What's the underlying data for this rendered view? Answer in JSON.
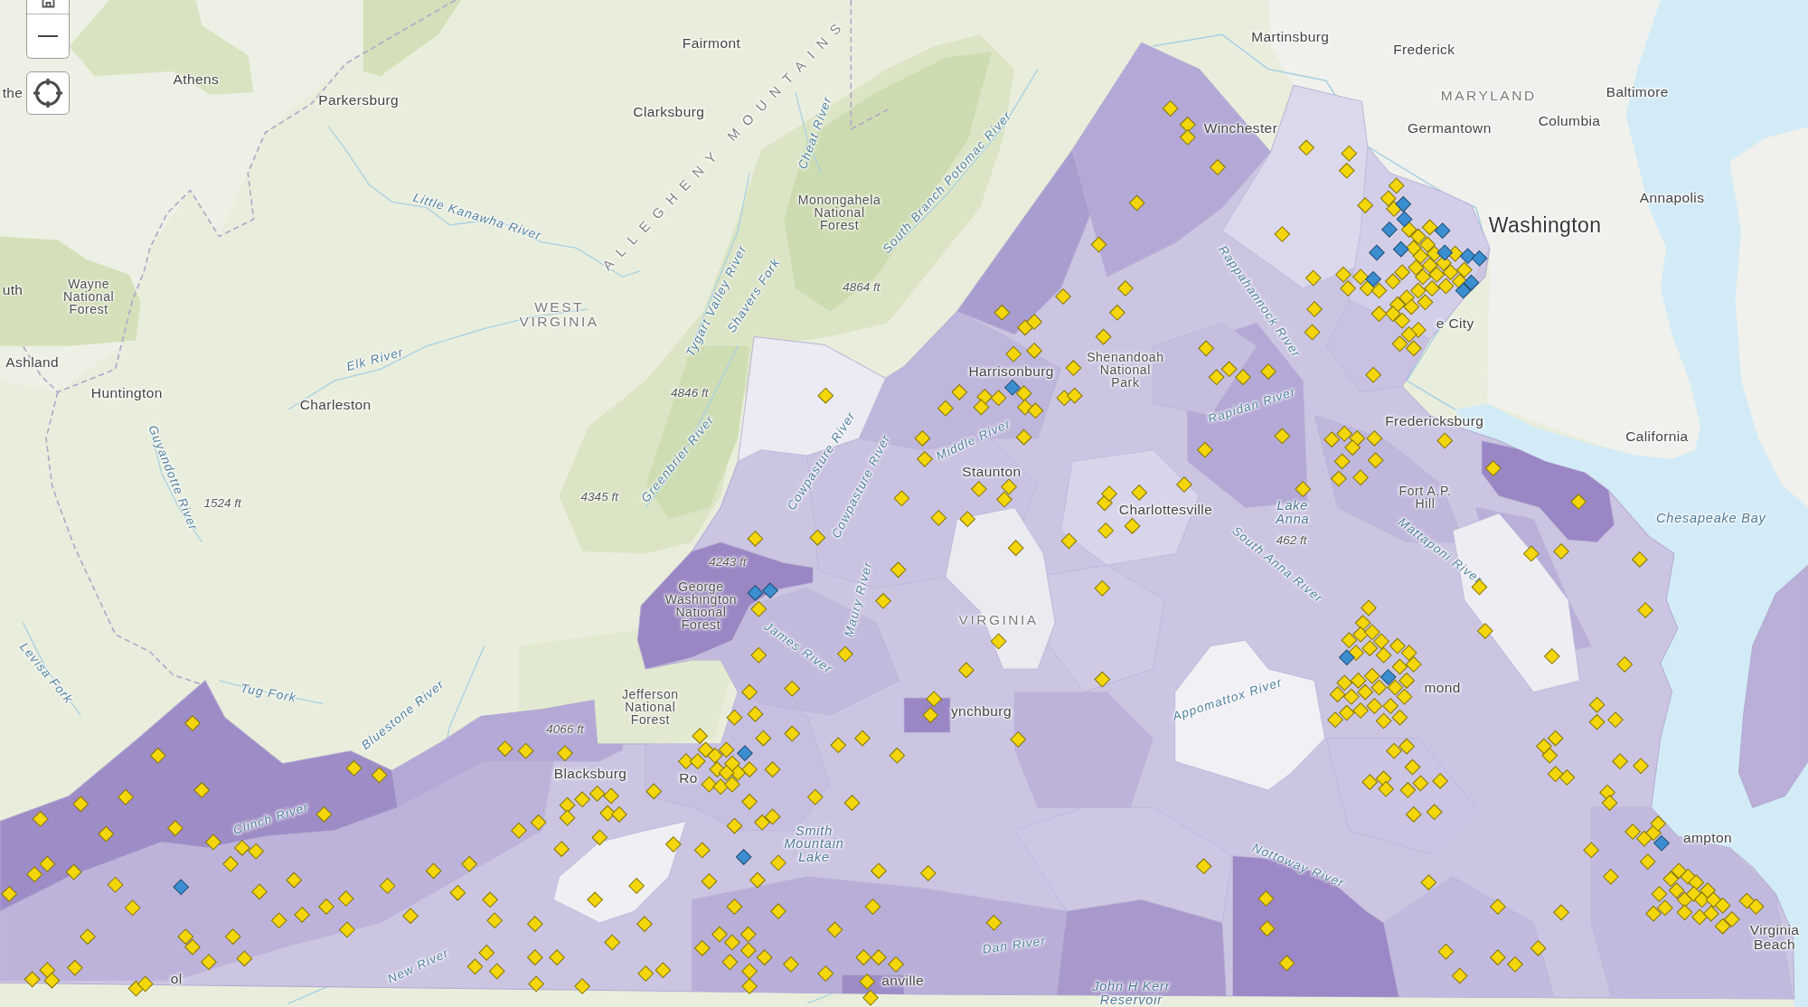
{
  "map_controls": [
    {
      "kind": "home"
    },
    {
      "kind": "zoom_out"
    },
    {
      "kind": "locate"
    }
  ],
  "map": {
    "labels": [
      {
        "text": "Fairmont",
        "kind": "city"
      },
      {
        "text": "Martinsburg",
        "kind": "city"
      },
      {
        "text": "Frederick",
        "kind": "city"
      },
      {
        "text": "the",
        "kind": "city"
      },
      {
        "text": "Athens",
        "kind": "city"
      },
      {
        "text": "Parkersburg",
        "kind": "city"
      },
      {
        "text": "MARYLAND",
        "kind": "state"
      },
      {
        "text": "Baltimore",
        "kind": "city"
      },
      {
        "text": "Clarksburg",
        "kind": "city"
      },
      {
        "text": "ALLEGHENY MOUNTAINS",
        "kind": "range"
      },
      {
        "text": "Cheat River",
        "kind": "river"
      },
      {
        "text": "Winchester",
        "kind": "city"
      },
      {
        "text": "Germantown",
        "kind": "city"
      },
      {
        "text": "Columbia",
        "kind": "city"
      },
      {
        "text": "Little Kanawha River",
        "kind": "river"
      },
      {
        "text": "Monongahela National Forest",
        "kind": "park"
      },
      {
        "text": "South Branch Potomac River",
        "kind": "river"
      },
      {
        "text": "Washington",
        "kind": "capital"
      },
      {
        "text": "Annapolis",
        "kind": "city"
      },
      {
        "text": "uth",
        "kind": "city"
      },
      {
        "text": "Wayne National Forest",
        "kind": "park"
      },
      {
        "text": "WEST VIRGINIA",
        "kind": "state"
      },
      {
        "text": "Tygart Valley River",
        "kind": "river"
      },
      {
        "text": "Shavers Fork",
        "kind": "river"
      },
      {
        "text": "4864 ft",
        "kind": "elevation"
      },
      {
        "text": "Rappahannock River",
        "kind": "river"
      },
      {
        "text": "e City",
        "kind": "city"
      },
      {
        "text": "Ashland",
        "kind": "city"
      },
      {
        "text": "Huntington",
        "kind": "city"
      },
      {
        "text": "Charleston",
        "kind": "city"
      },
      {
        "text": "Elk River",
        "kind": "river"
      },
      {
        "text": "4846 ft",
        "kind": "elevation"
      },
      {
        "text": "Harrisonburg",
        "kind": "city"
      },
      {
        "text": "Shenandoah National Park",
        "kind": "park"
      },
      {
        "text": "Rapidan River",
        "kind": "river"
      },
      {
        "text": "Guyandotte River",
        "kind": "river"
      },
      {
        "text": "Greenbrier River",
        "kind": "river"
      },
      {
        "text": "Cowpasture River",
        "kind": "river"
      },
      {
        "text": "Cowpasture River",
        "kind": "river"
      },
      {
        "text": "Middle River",
        "kind": "river"
      },
      {
        "text": "Staunton",
        "kind": "city"
      },
      {
        "text": "Fredericksburg",
        "kind": "city"
      },
      {
        "text": "California",
        "kind": "city"
      },
      {
        "text": "1524 ft",
        "kind": "elevation"
      },
      {
        "text": "4345 ft",
        "kind": "elevation"
      },
      {
        "text": "Charlottesville",
        "kind": "city"
      },
      {
        "text": "Lake Anna",
        "kind": "water"
      },
      {
        "text": "Fort A.P. Hill",
        "kind": "park"
      },
      {
        "text": "Chesapeake Bay",
        "kind": "water"
      },
      {
        "text": "4243 ft",
        "kind": "elevation"
      },
      {
        "text": "South Anna River",
        "kind": "river"
      },
      {
        "text": "462 ft",
        "kind": "elevation"
      },
      {
        "text": "Mattaponi River",
        "kind": "river"
      },
      {
        "text": "George Washington National Forest",
        "kind": "park"
      },
      {
        "text": "James River",
        "kind": "river"
      },
      {
        "text": "Maury River",
        "kind": "river"
      },
      {
        "text": "VIRGINIA",
        "kind": "state"
      },
      {
        "text": "Levisa Fork",
        "kind": "river"
      },
      {
        "text": "Tug Fork",
        "kind": "river"
      },
      {
        "text": "Bluestone River",
        "kind": "river"
      },
      {
        "text": "Jefferson National Forest",
        "kind": "park"
      },
      {
        "text": "ynchburg",
        "kind": "city"
      },
      {
        "text": "Appomattox River",
        "kind": "river"
      },
      {
        "text": "mond",
        "kind": "city"
      },
      {
        "text": "4066 ft",
        "kind": "elevation"
      },
      {
        "text": "Blacksburg",
        "kind": "city"
      },
      {
        "text": "Ro",
        "kind": "city"
      },
      {
        "text": "Clinch River",
        "kind": "river"
      },
      {
        "text": "Smith Mountain Lake",
        "kind": "water"
      },
      {
        "text": "Nottoway River",
        "kind": "river"
      },
      {
        "text": "ampton",
        "kind": "city"
      },
      {
        "text": "ol",
        "kind": "city"
      },
      {
        "text": "New River",
        "kind": "river"
      },
      {
        "text": "anville",
        "kind": "city"
      },
      {
        "text": "Dan River",
        "kind": "river"
      },
      {
        "text": "John H Kerr Reservoir",
        "kind": "water"
      },
      {
        "text": "Virginia Beach",
        "kind": "city"
      }
    ],
    "marker_layers": [
      {
        "color": "#f3d60b"
      },
      {
        "color": "#3b8ed0"
      }
    ]
  }
}
